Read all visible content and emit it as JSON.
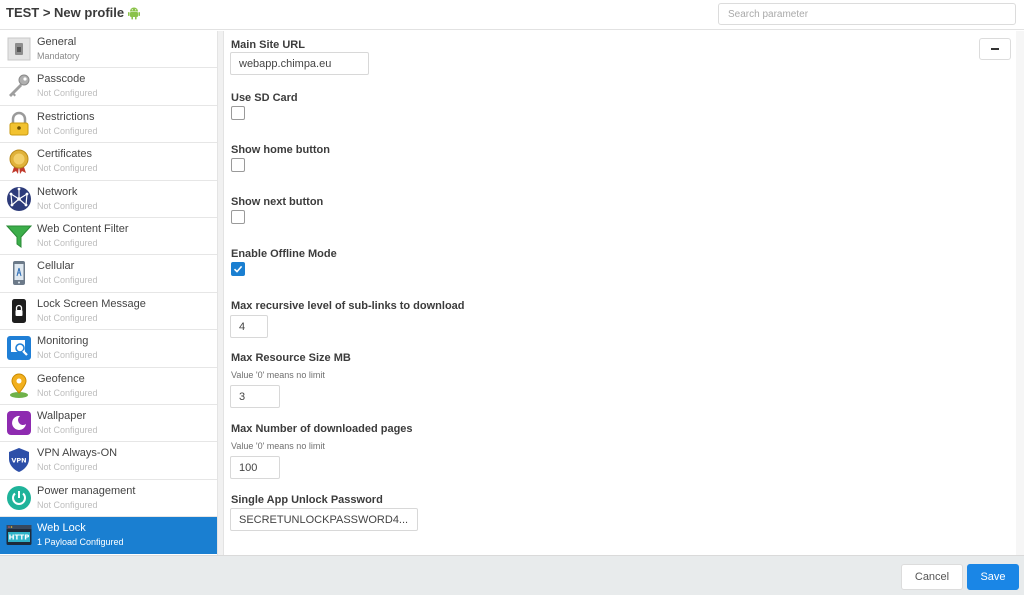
{
  "header": {
    "breadcrumb": "TEST > New profile",
    "platform_icon": "android-icon",
    "search_placeholder": "Search parameter"
  },
  "sidebar": {
    "items": [
      {
        "label": "General",
        "status": "Mandatory",
        "icon": "general-icon"
      },
      {
        "label": "Passcode",
        "status": "Not Configured",
        "icon": "key-icon"
      },
      {
        "label": "Restrictions",
        "status": "Not Configured",
        "icon": "padlock-icon"
      },
      {
        "label": "Certificates",
        "status": "Not Configured",
        "icon": "certificate-icon"
      },
      {
        "label": "Network",
        "status": "Not Configured",
        "icon": "network-icon"
      },
      {
        "label": "Web Content Filter",
        "status": "Not Configured",
        "icon": "funnel-icon"
      },
      {
        "label": "Cellular",
        "status": "Not Configured",
        "icon": "phone-icon"
      },
      {
        "label": "Lock Screen Message",
        "status": "Not Configured",
        "icon": "lock-screen-icon"
      },
      {
        "label": "Monitoring",
        "status": "Not Configured",
        "icon": "monitoring-icon"
      },
      {
        "label": "Geofence",
        "status": "Not Configured",
        "icon": "location-pin-icon"
      },
      {
        "label": "Wallpaper",
        "status": "Not Configured",
        "icon": "wallpaper-icon"
      },
      {
        "label": "VPN Always-ON",
        "status": "Not Configured",
        "icon": "vpn-shield-icon"
      },
      {
        "label": "Power management",
        "status": "Not Configured",
        "icon": "power-icon"
      },
      {
        "label": "Web Lock",
        "status": "1 Payload Configured",
        "icon": "http-icon"
      }
    ],
    "active_index": 13
  },
  "form": {
    "main_site_url": {
      "label": "Main Site URL",
      "value": "webapp.chimpa.eu"
    },
    "use_sd_card": {
      "label": "Use SD Card",
      "checked": false
    },
    "show_home_button": {
      "label": "Show home button",
      "checked": false
    },
    "show_next_button": {
      "label": "Show next button",
      "checked": false
    },
    "enable_offline_mode": {
      "label": "Enable Offline Mode",
      "checked": true
    },
    "max_recursive_level": {
      "label": "Max recursive level of sub-links to download",
      "value": "4"
    },
    "max_resource_size": {
      "label": "Max Resource Size MB",
      "hint": "Value '0' means no limit",
      "value": "3"
    },
    "max_downloaded_pages": {
      "label": "Max Number of downloaded pages",
      "hint": "Value '0' means no limit",
      "value": "100"
    },
    "unlock_password": {
      "label": "Single App Unlock Password",
      "value": "SECRETUNLOCKPASSWORD4..."
    }
  },
  "footer": {
    "cancel_label": "Cancel",
    "save_label": "Save"
  },
  "colors": {
    "accent": "#1a7fd1",
    "save_button": "#1a86e6",
    "footer_bg": "#e8ebec"
  }
}
